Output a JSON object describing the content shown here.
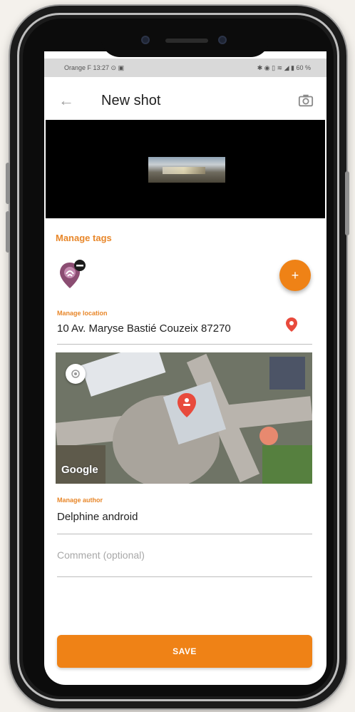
{
  "status_bar": {
    "left": "Orange F 13:27 ⊙ ▣",
    "right": "✱ ◉ ▯ ≋ ◢ ▮ 60 %"
  },
  "app_bar": {
    "title": "New shot",
    "back_icon": "arrow-left-icon",
    "camera_icon": "camera-icon"
  },
  "tags": {
    "label": "Manage tags",
    "add_button": "+",
    "tag_icon": "tag-pin-icon"
  },
  "location": {
    "label": "Manage location",
    "value": "10 Av. Maryse Bastié Couzeix 87270",
    "pin_icon": "location-pin-icon"
  },
  "map": {
    "attribution": "Google"
  },
  "author": {
    "label": "Manage author",
    "value": "Delphine android"
  },
  "comment": {
    "placeholder": "Comment (optional)"
  },
  "save_button": {
    "label": "SAVE"
  },
  "colors": {
    "accent": "#ef8216",
    "label_accent": "#e8872a",
    "pin_red": "#e84a3c"
  }
}
